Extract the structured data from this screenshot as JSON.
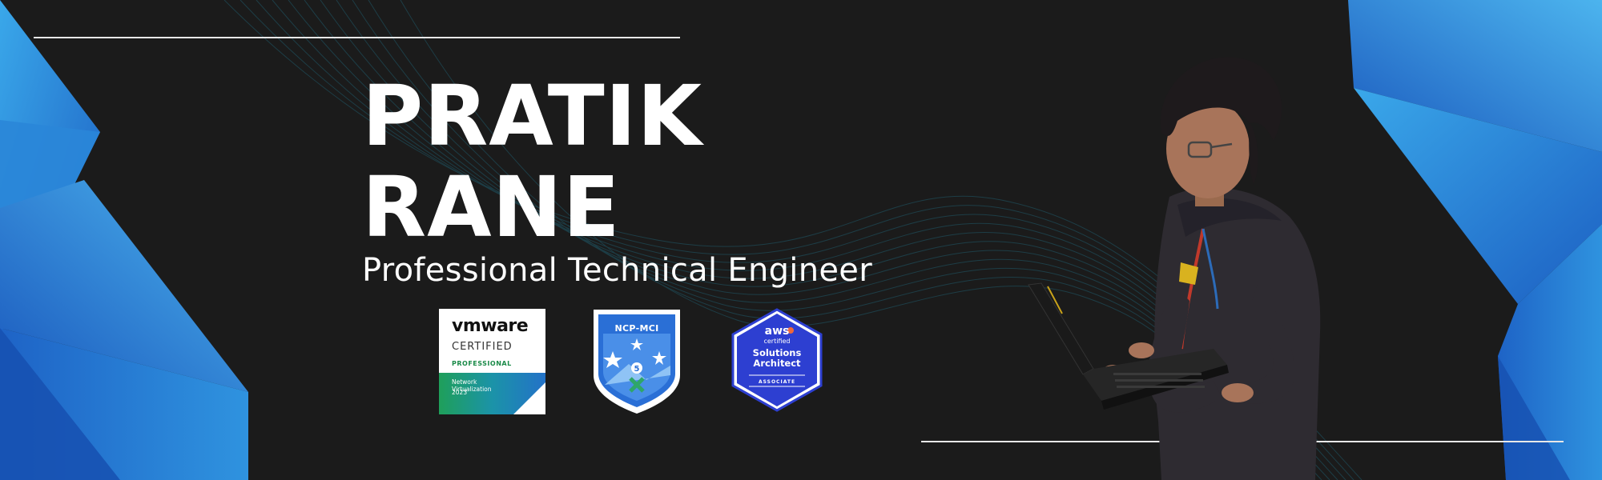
{
  "profile": {
    "first_name": "PRATIK",
    "last_name": "RANE",
    "title": "Professional Technical Engineer"
  },
  "badges": {
    "vmware": {
      "logo": "vmware",
      "certified": "CERTIFIED",
      "level": "PROFESSIONAL",
      "track": "Network Virtualization",
      "year": "2023"
    },
    "nutanix": {
      "title": "NCP-MCI",
      "icon": "stars-shield-icon"
    },
    "aws": {
      "logo": "aws",
      "certified": "certified",
      "role_line1": "Solutions",
      "role_line2": "Architect",
      "level": "ASSOCIATE"
    }
  },
  "colors": {
    "background": "#1b1b1b",
    "accent_blue": "#1e7bd0",
    "light_blue": "#3aa0e6",
    "text": "#ffffff",
    "aws_blue": "#2d3fd1",
    "ncp_blue": "#2a6fd6"
  }
}
